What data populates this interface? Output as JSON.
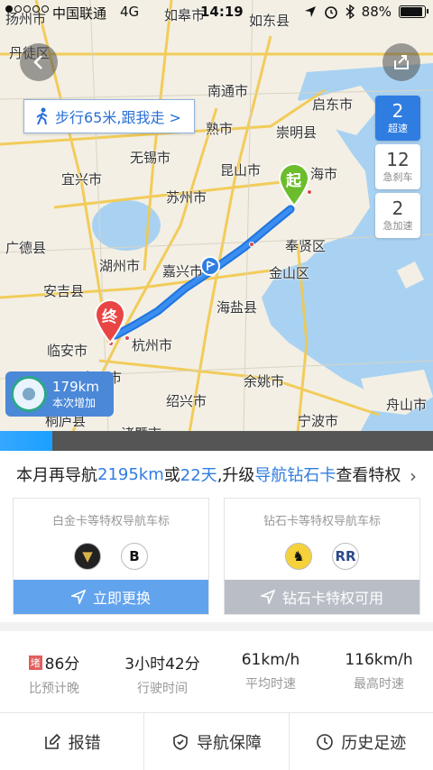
{
  "status_bar": {
    "carrier": "中国联通",
    "network": "4G",
    "time": "14:19",
    "battery": "88%"
  },
  "map": {
    "walk_tip": "步行65米,跟我走 >",
    "start_marker": "起",
    "end_marker": "终",
    "cities": [
      "扬州市",
      "如皋市",
      "如东县",
      "丹徒区",
      "南通市",
      "启东市",
      "熟市",
      "崇明县",
      "无锡市",
      "宜兴市",
      "昆山市",
      "苏州市",
      "奉贤区",
      "广德县",
      "湖州市",
      "嘉兴市",
      "金山区",
      "安吉县",
      "海盐县",
      "临安市",
      "杭州市",
      "富阳市",
      "绍兴市",
      "余姚市",
      "舟山市",
      "桐庐县",
      "诸暨市",
      "宁波市",
      "海市"
    ],
    "stats": [
      {
        "value": "2",
        "label": "超速"
      },
      {
        "value": "12",
        "label": "急刹车"
      },
      {
        "value": "2",
        "label": "急加速"
      }
    ],
    "mileage": {
      "km": "179km",
      "label": "本次增加"
    },
    "progress_fraction": 0.12
  },
  "upgrade": {
    "t1": "本月再导航",
    "km": "2195km",
    "t2": "或",
    "days": "22天",
    "t3": ",升级",
    "card": "导航钻石卡",
    "t4": "查看特权"
  },
  "cards": {
    "left": {
      "title": "白金卡等特权导航车标",
      "button": "立即更换"
    },
    "right": {
      "title": "钻石卡等特权导航车标",
      "button": "钻石卡特权可用"
    }
  },
  "metrics": [
    {
      "tag": "堵",
      "value": "86分",
      "label": "比预计晚"
    },
    {
      "value": "3小时42分",
      "label": "行驶时间"
    },
    {
      "value": "61km/h",
      "label": "平均时速"
    },
    {
      "value": "116km/h",
      "label": "最高时速"
    }
  ],
  "actions": [
    {
      "label": "报错",
      "icon": "edit-icon"
    },
    {
      "label": "导航保障",
      "icon": "shield-icon"
    },
    {
      "label": "历史足迹",
      "icon": "clock-icon"
    }
  ]
}
